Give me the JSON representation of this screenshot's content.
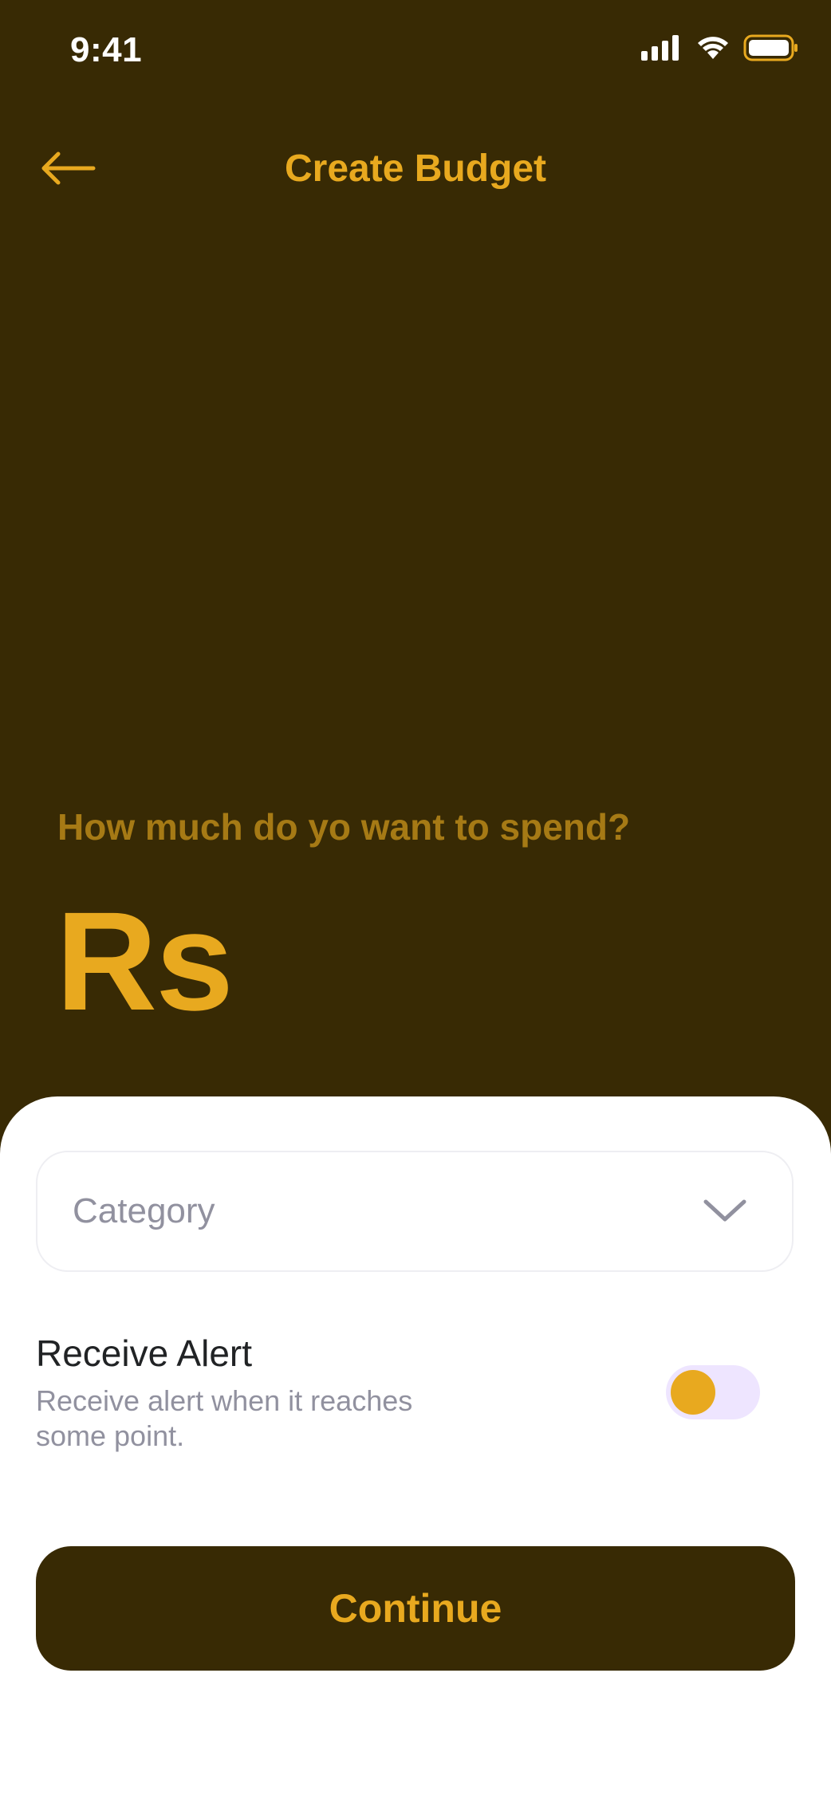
{
  "status_bar": {
    "time": "9:41",
    "icons": [
      "signal-icon",
      "wifi-icon",
      "battery-icon"
    ]
  },
  "header": {
    "title": "Create Budget",
    "back_icon": "arrow-left-icon"
  },
  "amount_section": {
    "prompt": "How much do yo want to spend?",
    "currency": "Rs"
  },
  "form": {
    "category": {
      "placeholder": "Category",
      "icon": "chevron-down-icon"
    },
    "alert": {
      "title": "Receive Alert",
      "description": "Receive alert when it reaches some point."
    },
    "continue_label": "Continue"
  },
  "colors": {
    "background": "#382A04",
    "accent": "#E8A91F",
    "prompt_text": "#A67A15",
    "sheet": "#FFFFFF",
    "muted_text": "#91919F",
    "toggle_track": "#EEE5FF"
  }
}
